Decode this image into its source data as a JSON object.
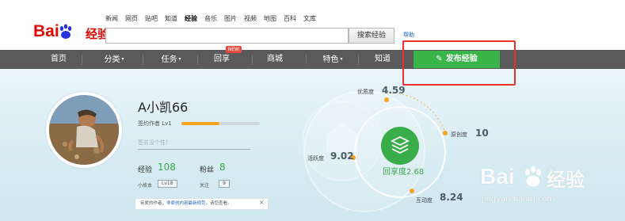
{
  "logo": {
    "bai": "Bai",
    "du": "du",
    "jingyan": "经验"
  },
  "topnav": [
    "新闻",
    "网页",
    "贴吧",
    "知道",
    "经验",
    "音乐",
    "图片",
    "视频",
    "地图",
    "百科",
    "文库"
  ],
  "topnav_active": "经验",
  "search": {
    "value": "",
    "button": "搜索经验",
    "help": "帮助"
  },
  "navbar": {
    "items": [
      {
        "label": "首页",
        "caret": false
      },
      {
        "label": "分类",
        "caret": true
      },
      {
        "label": "任务",
        "caret": true
      },
      {
        "label": "回享",
        "caret": false
      },
      {
        "label": "商城",
        "caret": false
      },
      {
        "label": "特色",
        "caret": true
      },
      {
        "label": "知道",
        "caret": false
      }
    ],
    "new_badge": "NEW",
    "publish": "发布经验",
    "publish_icon": "pen-icon",
    "caret_glyph": "▾"
  },
  "profile": {
    "username": "A小凯66",
    "level_label": "签约作者 Lv1",
    "level_progress": 0.48,
    "signature_placeholder": "签名没个性！",
    "experience_label": "经验",
    "experience_value": "108",
    "fans_label": "粉丝",
    "fans_value": "8",
    "rank_label": "小故本",
    "rank_value": "Lv18",
    "follow_label": "关注",
    "follow_value": "9",
    "notice_prefix": "亲爱的作者，",
    "notice_link": "非原创内容最新规范",
    "notice_suffix": "，请您查看。",
    "notice_close": "×"
  },
  "metrics": {
    "quality_label": "优质度",
    "quality_value": "4.59",
    "originality_label": "原创度",
    "originality_value": "10",
    "activity_label": "活跃度",
    "activity_value": "9.02",
    "interaction_label": "互动度",
    "interaction_value": "8.24",
    "center_label": "回享度",
    "center_value": "2.68"
  },
  "watermark": {
    "brand": "Bai",
    "brand_tail": "经验",
    "url": "jingyan.baidu.com"
  },
  "colors": {
    "nav_bg": "#5a5a5a",
    "publish_green": "#39b54a",
    "highlight_red": "#e8302c",
    "metric_orange": "#f6a623"
  }
}
